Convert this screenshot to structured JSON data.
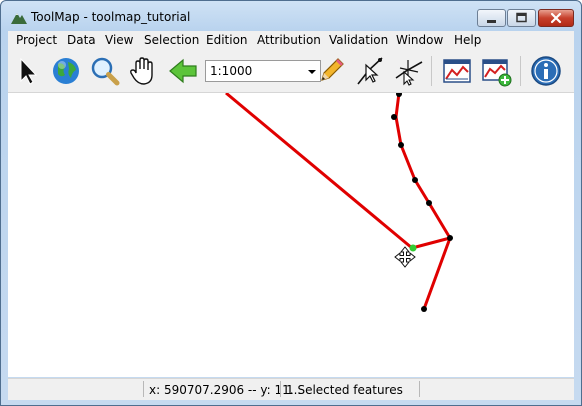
{
  "window": {
    "title": "ToolMap - toolmap_tutorial",
    "minimize_icon": "minimize-icon",
    "maximize_icon": "maximize-icon",
    "close_icon": "close-icon"
  },
  "menubar": {
    "items": [
      "Project",
      "Data",
      "View",
      "Selection",
      "Edition",
      "Attribution",
      "Validation",
      "Window",
      "Help"
    ]
  },
  "toolbar": {
    "tools": [
      {
        "name": "select-tool",
        "icon": "arrow-cursor-icon"
      },
      {
        "name": "zoom-full-tool",
        "icon": "globe-icon"
      },
      {
        "name": "zoom-tool",
        "icon": "magnifier-icon"
      },
      {
        "name": "pan-tool",
        "icon": "hand-icon"
      },
      {
        "name": "previous-zoom-tool",
        "icon": "green-back-arrow-icon"
      },
      {
        "name": "draw-tool",
        "icon": "pencil-icon"
      },
      {
        "name": "modify-tool",
        "icon": "edit-vertex-icon"
      },
      {
        "name": "cut-line-tool",
        "icon": "cut-line-icon"
      },
      {
        "name": "profile-tool",
        "icon": "profile-chart-icon"
      },
      {
        "name": "add-profile-tool",
        "icon": "profile-add-icon"
      },
      {
        "name": "information-tool",
        "icon": "info-icon"
      }
    ],
    "scale": {
      "value": "1:1000"
    }
  },
  "map": {
    "line_color": "#e00000",
    "vertex_color": "#000000",
    "selected_vertex_color": "#33cc33",
    "cursor_icon": "move-cursor-icon"
  },
  "statusbar": {
    "coordinates": "x: 590707.2906 -- y: 11...",
    "selection": "1 Selected features"
  }
}
